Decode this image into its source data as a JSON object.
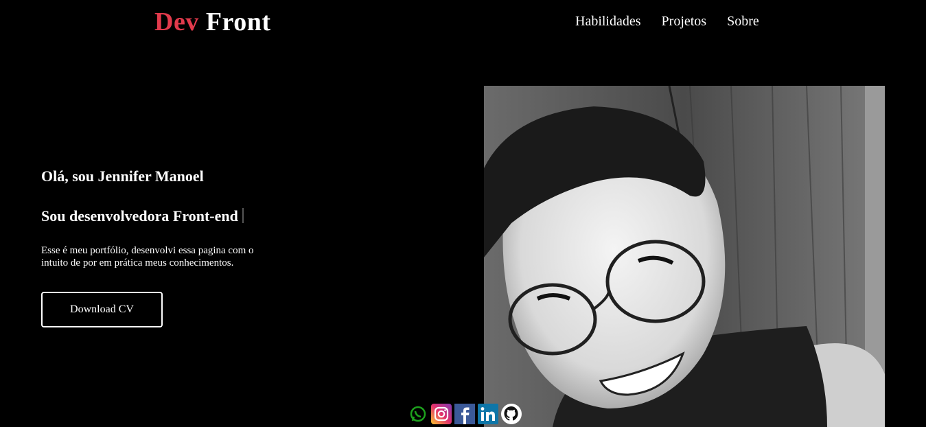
{
  "header": {
    "logo_accent": "Dev",
    "logo_rest": "Front",
    "nav": [
      {
        "label": "Habilidades"
      },
      {
        "label": "Projetos"
      },
      {
        "label": "Sobre"
      }
    ]
  },
  "hero": {
    "greeting": "Olá, sou Jennifer Manoel",
    "role": "Sou desenvolvedora Front-end",
    "description": "Esse é meu portfólio, desenvolvi essa pagina com o intuito de por em prática meus conhecimentos.",
    "cv_button": "Download CV"
  },
  "social": [
    {
      "icon": "whatsapp-icon",
      "color": "#1da11d"
    },
    {
      "icon": "instagram-icon",
      "color": "#d6249f"
    },
    {
      "icon": "facebook-icon",
      "color": "#3b5998"
    },
    {
      "icon": "linkedin-icon",
      "color": "#0e76a8"
    },
    {
      "icon": "github-icon",
      "color": "#ffffff"
    }
  ],
  "colors": {
    "accent": "#e23a4c",
    "background": "#000000",
    "text": "#ffffff"
  }
}
